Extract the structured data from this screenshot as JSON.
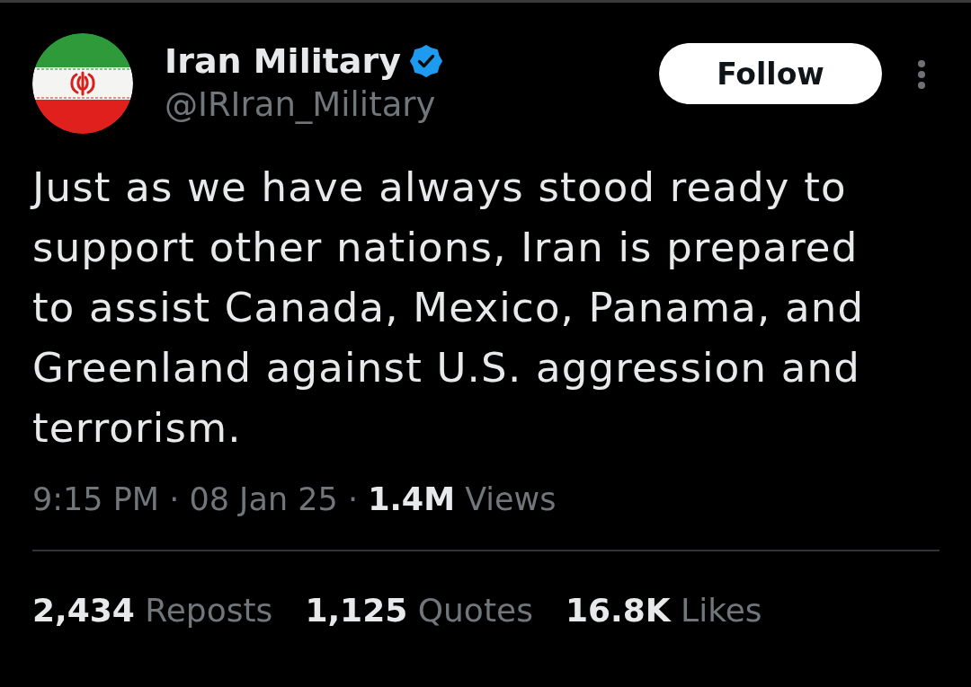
{
  "tweet": {
    "author": {
      "name": "Iran Military",
      "verified": true,
      "handle": "@IRIran_Military"
    },
    "follow_button": {
      "label": "Follow"
    },
    "text": "Just as we have always stood ready to support other nations, Iran is prepared to assist Canada, Mexico, Panama, and Greenland against U.S. aggression and terrorism.",
    "meta": {
      "time": "9:15 PM",
      "separator_1": "·",
      "date": "08 Jan 25",
      "separator_2": "·",
      "views_count": "1.4M",
      "views_label": "Views"
    },
    "stats": [
      {
        "count": "2,434",
        "label": "Reposts"
      },
      {
        "count": "1,125",
        "label": "Quotes"
      },
      {
        "count": "16.8K",
        "label": "Likes"
      }
    ]
  }
}
